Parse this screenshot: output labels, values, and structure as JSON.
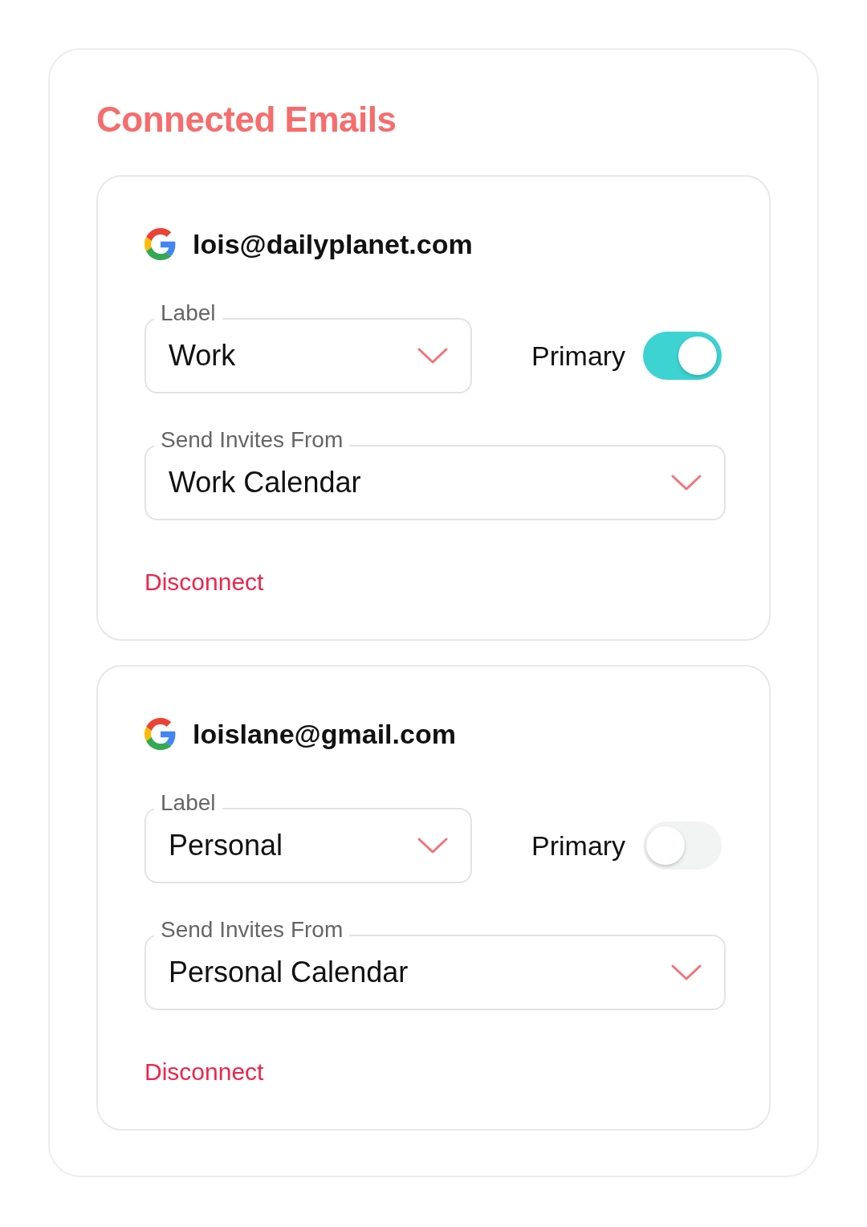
{
  "title": "Connected Emails",
  "accounts": [
    {
      "email": "lois@dailyplanet.com",
      "label_field": {
        "label": "Label",
        "value": "Work"
      },
      "primary": {
        "label": "Primary",
        "on": true
      },
      "invites_field": {
        "label": "Send Invites From",
        "value": "Work Calendar"
      },
      "disconnect": "Disconnect"
    },
    {
      "email": "loislane@gmail.com",
      "label_field": {
        "label": "Label",
        "value": "Personal"
      },
      "primary": {
        "label": "Primary",
        "on": false
      },
      "invites_field": {
        "label": "Send Invites From",
        "value": "Personal Calendar"
      },
      "disconnect": "Disconnect"
    }
  ]
}
